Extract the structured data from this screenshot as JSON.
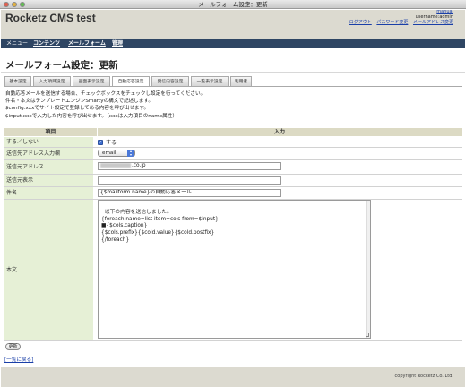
{
  "window": {
    "title": "メールフォーム設定：更新"
  },
  "header": {
    "logo": "Rocketz CMS test",
    "manual": "manual",
    "user": "username:admin",
    "links": [
      "ログアウト",
      "パスワード変更",
      "メールアドレス変更"
    ]
  },
  "menu": [
    "メニュー",
    "コンテンツ",
    "メールフォーム",
    "管理"
  ],
  "page": {
    "title": "メールフォーム設定：更新"
  },
  "tabs": [
    "基本設定",
    "入力項目設定",
    "画面表示設定",
    "自動応答設定",
    "受信内容設定",
    "一覧表示設定",
    "利用者"
  ],
  "description": [
    "自動応答メールを送信する場合、チェックボックスをチェックし設定を行ってください。",
    "件名・本文はテンプレートエンジンSmartyの構文で記述します。",
    "$config.xxxでサイト設定で登録してある内容を呼び出せます。",
    "$input.xxxで入力した内容を呼び出せます。（xxxは入力項目のname属性）"
  ],
  "table": {
    "header_item": "項目",
    "header_input": "入力",
    "rows": {
      "enable": "する／しない",
      "to_field": "送信先アドレス入力欄",
      "from_address": "送信元アドレス",
      "from_name": "送信元表示",
      "subject": "件名",
      "body": "本文"
    }
  },
  "form": {
    "enable_checked": true,
    "enable_label": "する",
    "to_field_selected": "email",
    "from_address_suffix": ".co.jp",
    "from_name_value": "",
    "subject_value": "{$mailform.name}の自動応答メール",
    "body_value": "以下の内容を送信しました。\n{foreach name=list item=cols from=$input}\n■{$cols.caption}\n{$cols.prefix}{$cold.value}{$cold.postfix}\n{/foreach}"
  },
  "buttons": {
    "update": "更新"
  },
  "back_link": "[一覧に戻る]",
  "footer": {
    "copyright": "copyright Rocketz Co.,Ltd."
  },
  "colors": {
    "menubar": "#2e4563",
    "header": "#dcdad0",
    "label_bg": "#e6f0d6",
    "link": "#1a3fa8"
  },
  "icons": [
    "checkbox-check-icon",
    "select-arrow-icon"
  ]
}
